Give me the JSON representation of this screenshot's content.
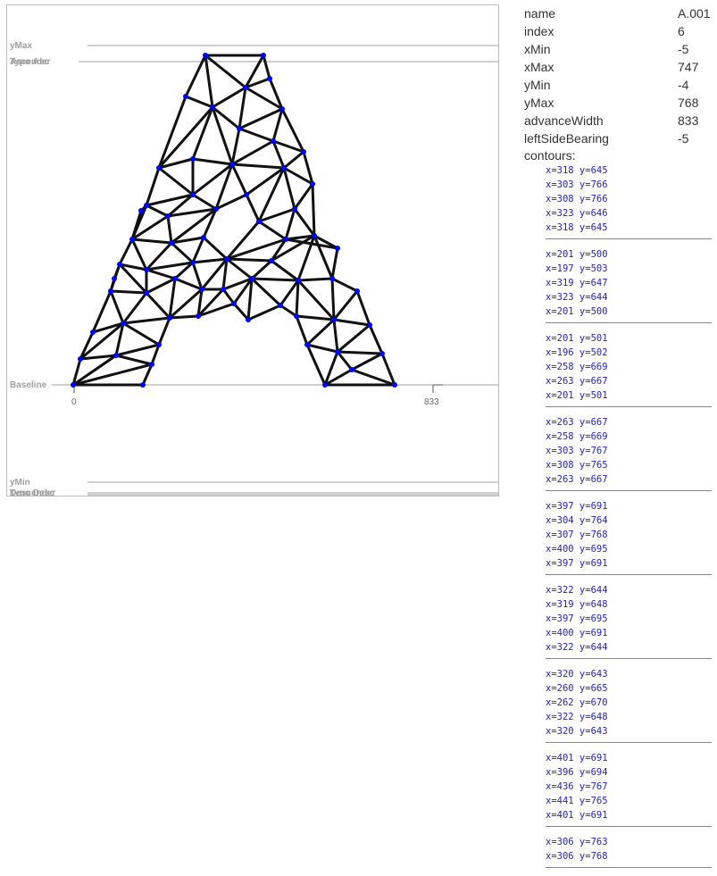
{
  "metrics": {
    "ymax_label": "yMax",
    "asc_label_a": "Typo Asc",
    "asc_label_b": "Ascender",
    "baseline_label": "Baseline",
    "ymin_label": "yMin",
    "desc_label_a": "Typo Desc",
    "desc_label_b": "Descender",
    "origin_tick": "0",
    "advance_tick": "833"
  },
  "info": {
    "rows": [
      {
        "key": "name",
        "value": "A.001"
      },
      {
        "key": "index",
        "value": "6"
      },
      {
        "key": "xMin",
        "value": "-5"
      },
      {
        "key": "xMax",
        "value": "747"
      },
      {
        "key": "yMin",
        "value": "-4"
      },
      {
        "key": "yMax",
        "value": "768"
      },
      {
        "key": "advanceWidth",
        "value": "833"
      },
      {
        "key": "leftSideBearing",
        "value": "-5"
      }
    ],
    "contours_label": "contours:"
  },
  "contours": [
    [
      "x=318 y=645",
      "x=303 y=766",
      "x=308 y=766",
      "x=323 y=646",
      "x=318 y=645"
    ],
    [
      "x=201 y=500",
      "x=197 y=503",
      "x=319 y=647",
      "x=323 y=644",
      "x=201 y=500"
    ],
    [
      "x=201 y=501",
      "x=196 y=502",
      "x=258 y=669",
      "x=263 y=667",
      "x=201 y=501"
    ],
    [
      "x=263 y=667",
      "x=258 y=669",
      "x=303 y=767",
      "x=308 y=765",
      "x=263 y=667"
    ],
    [
      "x=397 y=691",
      "x=304 y=764",
      "x=307 y=768",
      "x=400 y=695",
      "x=397 y=691"
    ],
    [
      "x=322 y=644",
      "x=319 y=648",
      "x=397 y=695",
      "x=400 y=691",
      "x=322 y=644"
    ],
    [
      "x=320 y=643",
      "x=260 y=665",
      "x=262 y=670",
      "x=322 y=648",
      "x=320 y=643"
    ],
    [
      "x=401 y=691",
      "x=396 y=694",
      "x=436 y=767",
      "x=441 y=765",
      "x=401 y=691"
    ],
    [
      "x=306 y=763",
      "x=306 y=768"
    ]
  ],
  "colors": {
    "point": "#0000ff",
    "edge": "#111111",
    "guide": "#a0a0a0",
    "contour_text": "#2222cc"
  }
}
